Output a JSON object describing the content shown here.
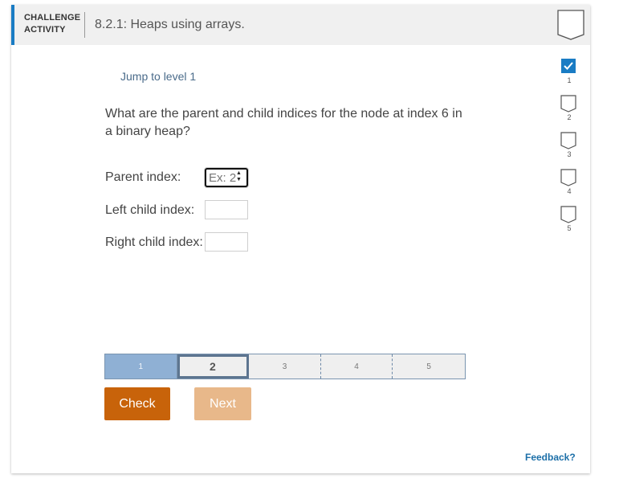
{
  "header": {
    "tag_line1": "CHALLENGE",
    "tag_line2": "ACTIVITY",
    "title": "8.2.1: Heaps using arrays."
  },
  "jump_link": "Jump to level 1",
  "question": "What are the parent and child indices for the node at index 6 in a binary heap?",
  "fields": [
    {
      "label": "Parent index:",
      "value": "",
      "placeholder": "Ex: 2"
    },
    {
      "label": "Left child index:",
      "value": "",
      "placeholder": ""
    },
    {
      "label": "Right child index:",
      "value": "",
      "placeholder": ""
    }
  ],
  "levels": [
    {
      "num": "1",
      "completed": true
    },
    {
      "num": "2",
      "completed": false
    },
    {
      "num": "3",
      "completed": false
    },
    {
      "num": "4",
      "completed": false
    },
    {
      "num": "5",
      "completed": false
    }
  ],
  "progress": {
    "segments": [
      "1",
      "2",
      "3",
      "4",
      "5"
    ],
    "current": 2
  },
  "buttons": {
    "check": "Check",
    "next": "Next"
  },
  "feedback": "Feedback?",
  "colors": {
    "accent": "#1a7cc4",
    "check_button": "#c8630a",
    "next_button_disabled": "#e8b88a",
    "progress_done": "#8fb0d4"
  }
}
